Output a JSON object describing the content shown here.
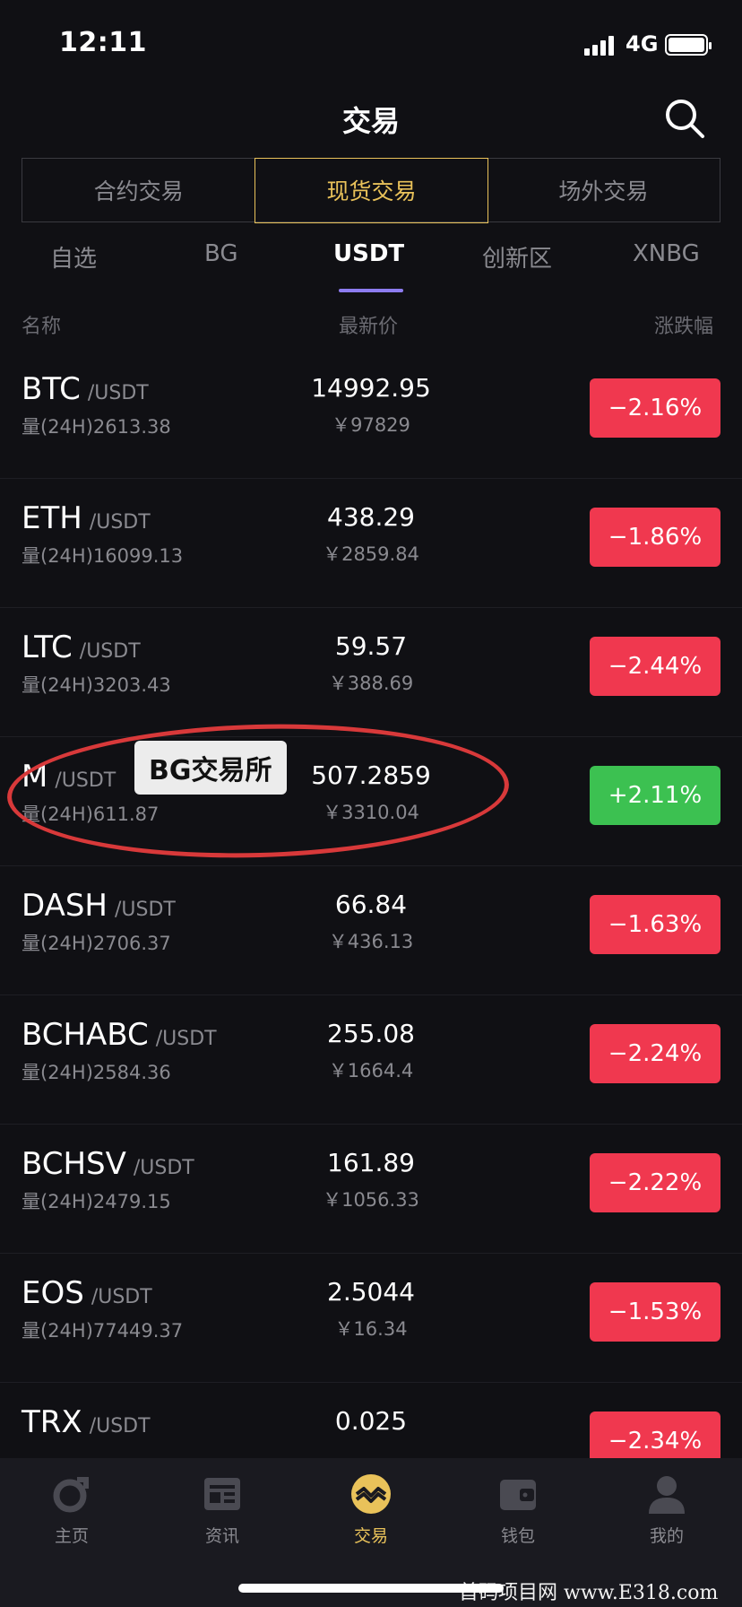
{
  "status_bar": {
    "time": "12:11",
    "network": "4G"
  },
  "header": {
    "title": "交易"
  },
  "segments": [
    {
      "label": "合约交易",
      "active": false
    },
    {
      "label": "现货交易",
      "active": true
    },
    {
      "label": "场外交易",
      "active": false
    }
  ],
  "tabs": [
    {
      "label": "自选",
      "active": false
    },
    {
      "label": "BG",
      "active": false
    },
    {
      "label": "USDT",
      "active": true
    },
    {
      "label": "创新区",
      "active": false
    },
    {
      "label": "XNBG",
      "active": false
    }
  ],
  "columns": {
    "name": "名称",
    "price": "最新价",
    "change": "涨跌幅"
  },
  "rows": [
    {
      "base": "BTC",
      "quote": "/USDT",
      "volume": "量(24H)2613.38",
      "price": "14992.95",
      "cny": "￥97829",
      "change": "−2.16%"
    },
    {
      "base": "ETH",
      "quote": "/USDT",
      "volume": "量(24H)16099.13",
      "price": "438.29",
      "cny": "￥2859.84",
      "change": "−1.86%"
    },
    {
      "base": "LTC",
      "quote": "/USDT",
      "volume": "量(24H)3203.43",
      "price": "59.57",
      "cny": "￥388.69",
      "change": "−2.44%"
    },
    {
      "base": "M",
      "quote": "/USDT",
      "volume": "量(24H)611.87",
      "price": "507.2859",
      "cny": "￥3310.04",
      "change": "+2.11%"
    },
    {
      "base": "DASH",
      "quote": "/USDT",
      "volume": "量(24H)2706.37",
      "price": "66.84",
      "cny": "￥436.13",
      "change": "−1.63%"
    },
    {
      "base": "BCHABC",
      "quote": "/USDT",
      "volume": "量(24H)2584.36",
      "price": "255.08",
      "cny": "￥1664.4",
      "change": "−2.24%"
    },
    {
      "base": "BCHSV",
      "quote": "/USDT",
      "volume": "量(24H)2479.15",
      "price": "161.89",
      "cny": "￥1056.33",
      "change": "−2.22%"
    },
    {
      "base": "EOS",
      "quote": "/USDT",
      "volume": "量(24H)77449.37",
      "price": "2.5044",
      "cny": "￥16.34",
      "change": "−1.53%"
    },
    {
      "base": "TRX",
      "quote": "/USDT",
      "volume": "",
      "price": "0.025",
      "cny": "",
      "change": "−2.34%"
    }
  ],
  "annotation": {
    "label": "BG交易所"
  },
  "nav": [
    {
      "label": "主页",
      "icon": "home-icon",
      "active": false
    },
    {
      "label": "资讯",
      "icon": "news-icon",
      "active": false
    },
    {
      "label": "交易",
      "icon": "trade-icon",
      "active": true
    },
    {
      "label": "钱包",
      "icon": "wallet-icon",
      "active": false
    },
    {
      "label": "我的",
      "icon": "profile-icon",
      "active": false
    }
  ],
  "watermark": "首码项目网 www.E318.com",
  "colors": {
    "accent": "#e9c25a",
    "down": "#f0384f",
    "up": "#3cc151",
    "tab_underline": "#8d7cf0"
  }
}
